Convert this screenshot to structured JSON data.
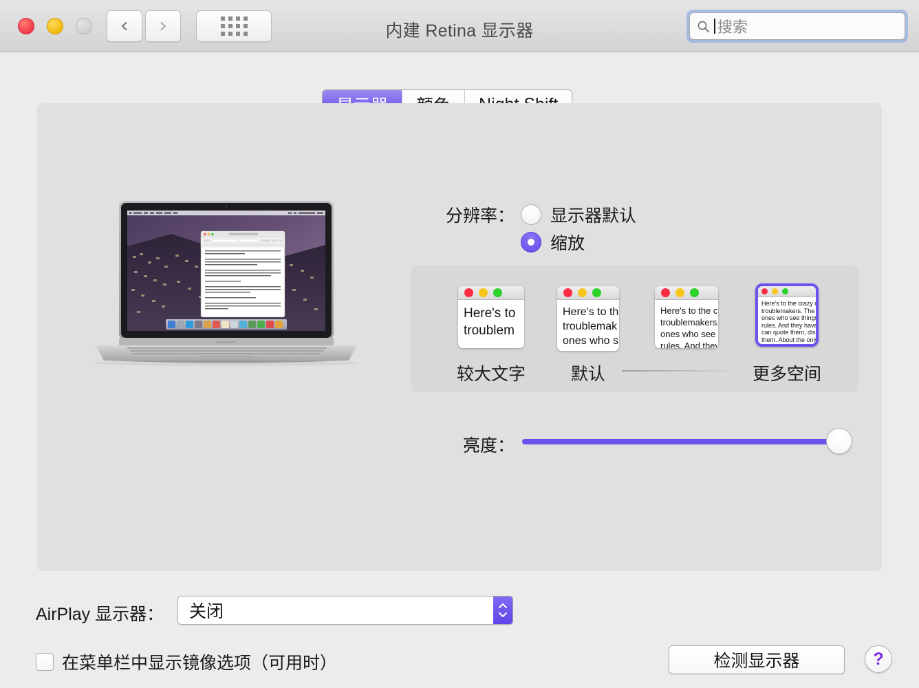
{
  "window": {
    "title": "内建 Retina 显示器",
    "traffic_lights": [
      "close",
      "minimize",
      "zoom"
    ],
    "nav": {
      "back": "back-chevron",
      "forward": "forward-chevron"
    },
    "grid_button": "show-all-icon"
  },
  "search": {
    "placeholder": "搜索",
    "value": "",
    "icon": "search-icon"
  },
  "tabs": [
    {
      "label": "显示器",
      "active": true
    },
    {
      "label": "颜色",
      "active": false
    },
    {
      "label": "Night Shift",
      "active": false
    }
  ],
  "preview": {
    "device_label": "MacBook Pro",
    "document_title": "Think Different.rtf",
    "document_text": "Here's to the crazy ones. The misfits. The rebels. The troublemakers. The round pegs in the square holes."
  },
  "resolution": {
    "label": "分辨率：",
    "options": [
      {
        "label": "显示器默认",
        "selected": false
      },
      {
        "label": "缩放",
        "selected": true
      }
    ]
  },
  "scaling": {
    "left_label": "较大文字",
    "default_label": "默认",
    "right_label": "更多空间",
    "selected_index": 3,
    "thumbnails": [
      {
        "text": "Here's to\ntroublem",
        "font_px": 19
      },
      {
        "text": "Here's to th\ntroublemak\nones who s",
        "font_px": 16
      },
      {
        "text": "Here's to the cr\ntroublemakers.\nones who see t\nrules. And they",
        "font_px": 13
      },
      {
        "text": "Here's to the crazy one\ntroublemakers. The rou\nones who see things dif\nrules. And they have no\ncan quote them, disagr\nthem. About the only th\nBecause they change t",
        "font_px": 9
      }
    ]
  },
  "brightness": {
    "label": "亮度：",
    "value_percent": 96
  },
  "airplay": {
    "label": "AirPlay 显示器：",
    "value": "关闭",
    "options": [
      "关闭"
    ]
  },
  "mirroring_checkbox": {
    "label": "在菜单栏中显示镜像选项（可用时）",
    "checked": false
  },
  "detect_button": {
    "label": "检测显示器"
  },
  "help_button": {
    "label": "?"
  },
  "colors": {
    "accent_purple": "#6a52ef",
    "tab_active_gradient_end": "#8d00f5",
    "help_purple": "#7a2ae0",
    "window_bg": "#ececec",
    "panel_bg": "#e0e0e0",
    "scalebox_bg": "#d8d8d8"
  }
}
